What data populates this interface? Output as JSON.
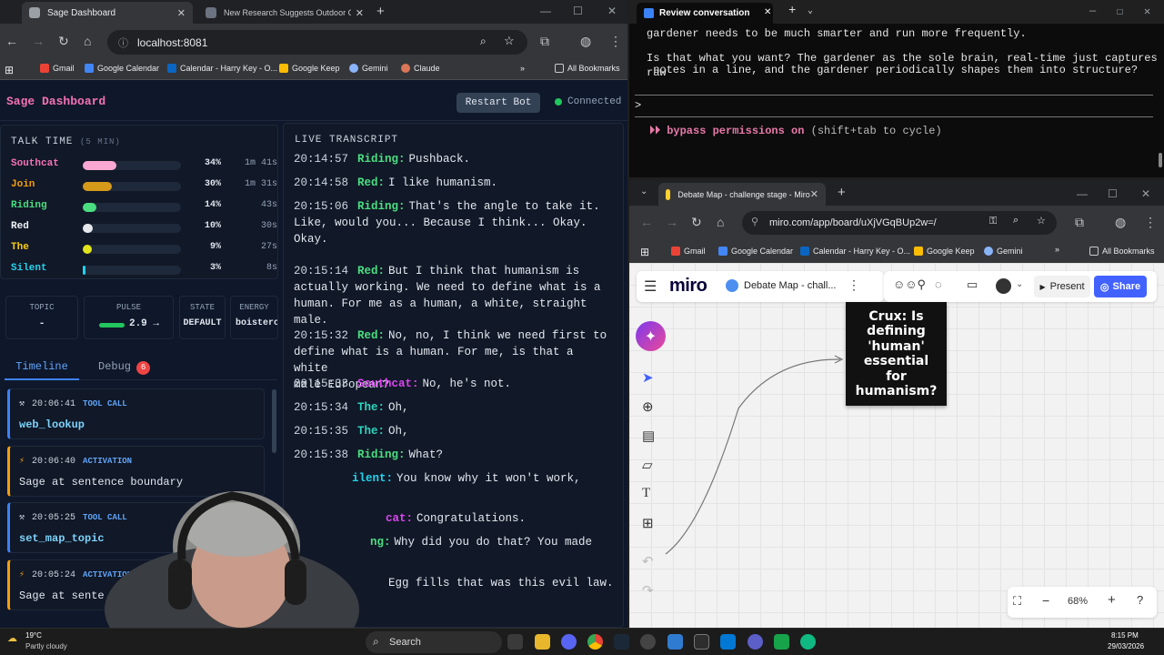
{
  "left_browser": {
    "tabs": [
      {
        "title": "Sage Dashboard"
      },
      {
        "title": "New Research Suggests Outdoor Cat..."
      }
    ],
    "url": "localhost:8081",
    "bookmarks": [
      "Gmail",
      "Google Calendar",
      "Calendar - Harry Key - O...",
      "Google Keep",
      "Gemini",
      "Claude"
    ],
    "all_bookmarks": "All Bookmarks"
  },
  "dashboard": {
    "title": "Sage Dashboard",
    "restart_label": "Restart Bot",
    "status": "Connected",
    "talk_time": {
      "title": "TALK TIME",
      "window": "(5 MIN)",
      "rows": [
        {
          "name": "Southcat",
          "pct_label": "34%",
          "pct": 34,
          "dur": "1m 41s",
          "color": "#f472b6",
          "bar": "#f9a8d4"
        },
        {
          "name": "Join",
          "pct_label": "30%",
          "pct": 30,
          "dur": "1m 31s",
          "color": "#f59e0b",
          "bar": "#d59a1a"
        },
        {
          "name": "Riding",
          "pct_label": "14%",
          "pct": 14,
          "dur": "43s",
          "color": "#4ade80",
          "bar": "#4ade80"
        },
        {
          "name": "Red",
          "pct_label": "10%",
          "pct": 10,
          "dur": "30s",
          "color": "#f1f5f9",
          "bar": "#e5e7eb"
        },
        {
          "name": "The",
          "pct_label": "9%",
          "pct": 9,
          "dur": "27s",
          "color": "#facc15",
          "bar": "#e2e31a"
        },
        {
          "name": "Silent",
          "pct_label": "3%",
          "pct": 3,
          "dur": "8s",
          "color": "#22d3ee",
          "bar": "#22d3ee"
        }
      ]
    },
    "stats": [
      {
        "label": "TOPIC",
        "value": "-"
      },
      {
        "label": "PULSE",
        "value": "2.9 →"
      },
      {
        "label": "STATE",
        "value": "DEFAULT"
      },
      {
        "label": "ENERGY",
        "value": "boistero"
      }
    ],
    "tabs": {
      "timeline": "Timeline",
      "debug": "Debug",
      "debug_count": "6"
    },
    "timeline": [
      {
        "time": "20:06:41",
        "kind": "TOOL CALL",
        "body": "web_lookup",
        "type": "tool"
      },
      {
        "time": "20:06:40",
        "kind": "ACTIVATION",
        "body": "Sage at sentence boundary",
        "type": "act"
      },
      {
        "time": "20:05:25",
        "kind": "TOOL CALL",
        "body": "set_map_topic",
        "type": "tool"
      },
      {
        "time": "20:05:24",
        "kind": "ACTIVATION",
        "body": "Sage at sente",
        "type": "act"
      }
    ],
    "transcript": {
      "title": "LIVE TRANSCRIPT",
      "lines": [
        {
          "time": "20:14:57",
          "speaker": "Riding:",
          "color": "#4ade80",
          "text": "Pushback."
        },
        {
          "time": "20:14:58",
          "speaker": "Red:",
          "color": "#4ade80",
          "text": "I like humanism."
        },
        {
          "time": "20:15:06",
          "speaker": "Riding:",
          "color": "#4ade80",
          "text": "That's the angle to take it.\nLike, would you... Because I think... Okay.\nOkay."
        },
        {
          "time": "20:15:14",
          "speaker": "Red:",
          "color": "#4ade80",
          "text": "But I think that humanism is\nactually working. We need to define what is a\nhuman. For me as a human, a white, straight\nmale."
        },
        {
          "time": "20:15:32",
          "speaker": "Red:",
          "color": "#4ade80",
          "text": "No, no, I think we need first to\ndefine what is a human. For me, is that a white\nmale European?"
        },
        {
          "time": "20:15:33",
          "speaker": "Southcat:",
          "color": "#d946ef",
          "text": "No, he's not."
        },
        {
          "time": "20:15:34",
          "speaker": "The:",
          "color": "#2dd4bf",
          "text": "Oh,"
        },
        {
          "time": "20:15:35",
          "speaker": "The:",
          "color": "#2dd4bf",
          "text": "Oh,"
        },
        {
          "time": "20:15:38",
          "speaker": "Riding:",
          "color": "#4ade80",
          "text": "What?"
        },
        {
          "time": "",
          "speaker": "ilent:",
          "color": "#22d3ee",
          "text": "You know why it won't work,"
        },
        {
          "time": "",
          "speaker": "cat:",
          "color": "#d946ef",
          "text": "Congratulations."
        },
        {
          "time": "",
          "speaker": "ng:",
          "color": "#4ade80",
          "text": "Why did you do that? You made"
        },
        {
          "time": "",
          "speaker": "",
          "color": "#e2e8f0",
          "text": "Egg fills that was this evil law."
        }
      ]
    }
  },
  "terminal": {
    "tab_title": "Review conversation",
    "lines": [
      "gardener needs to be much smarter and run more frequently.",
      "",
      "Is that what you want? The gardener as the sole brain, real-time just captures raw",
      " notes in a line, and the gardener periodically shapes them into structure?"
    ],
    "prompt": ">",
    "hint_strong": "⏵⏵ bypass permissions on",
    "hint_rest": "(shift+tab to cycle)"
  },
  "miro_browser": {
    "tab_title": "Debate Map - challenge stage - Miro",
    "url": "miro.com/app/board/uXjVGqBUp2w=/",
    "bookmarks": [
      "Gmail",
      "Google Calendar",
      "Calendar - Harry Key - O...",
      "Google Keep",
      "Gemini"
    ],
    "all_bookmarks": "All Bookmarks",
    "logo": "miro",
    "board_name": "Debate Map - chall...",
    "present": "Present",
    "share": "Share",
    "sticky": "Crux: Is defining 'human' essential for humanism?",
    "zoom": "68%"
  },
  "taskbar": {
    "weather_temp": "19°C",
    "weather_desc": "Partly cloudy",
    "search": "Search",
    "time": "8:15 PM",
    "date": "29/03/2026"
  }
}
